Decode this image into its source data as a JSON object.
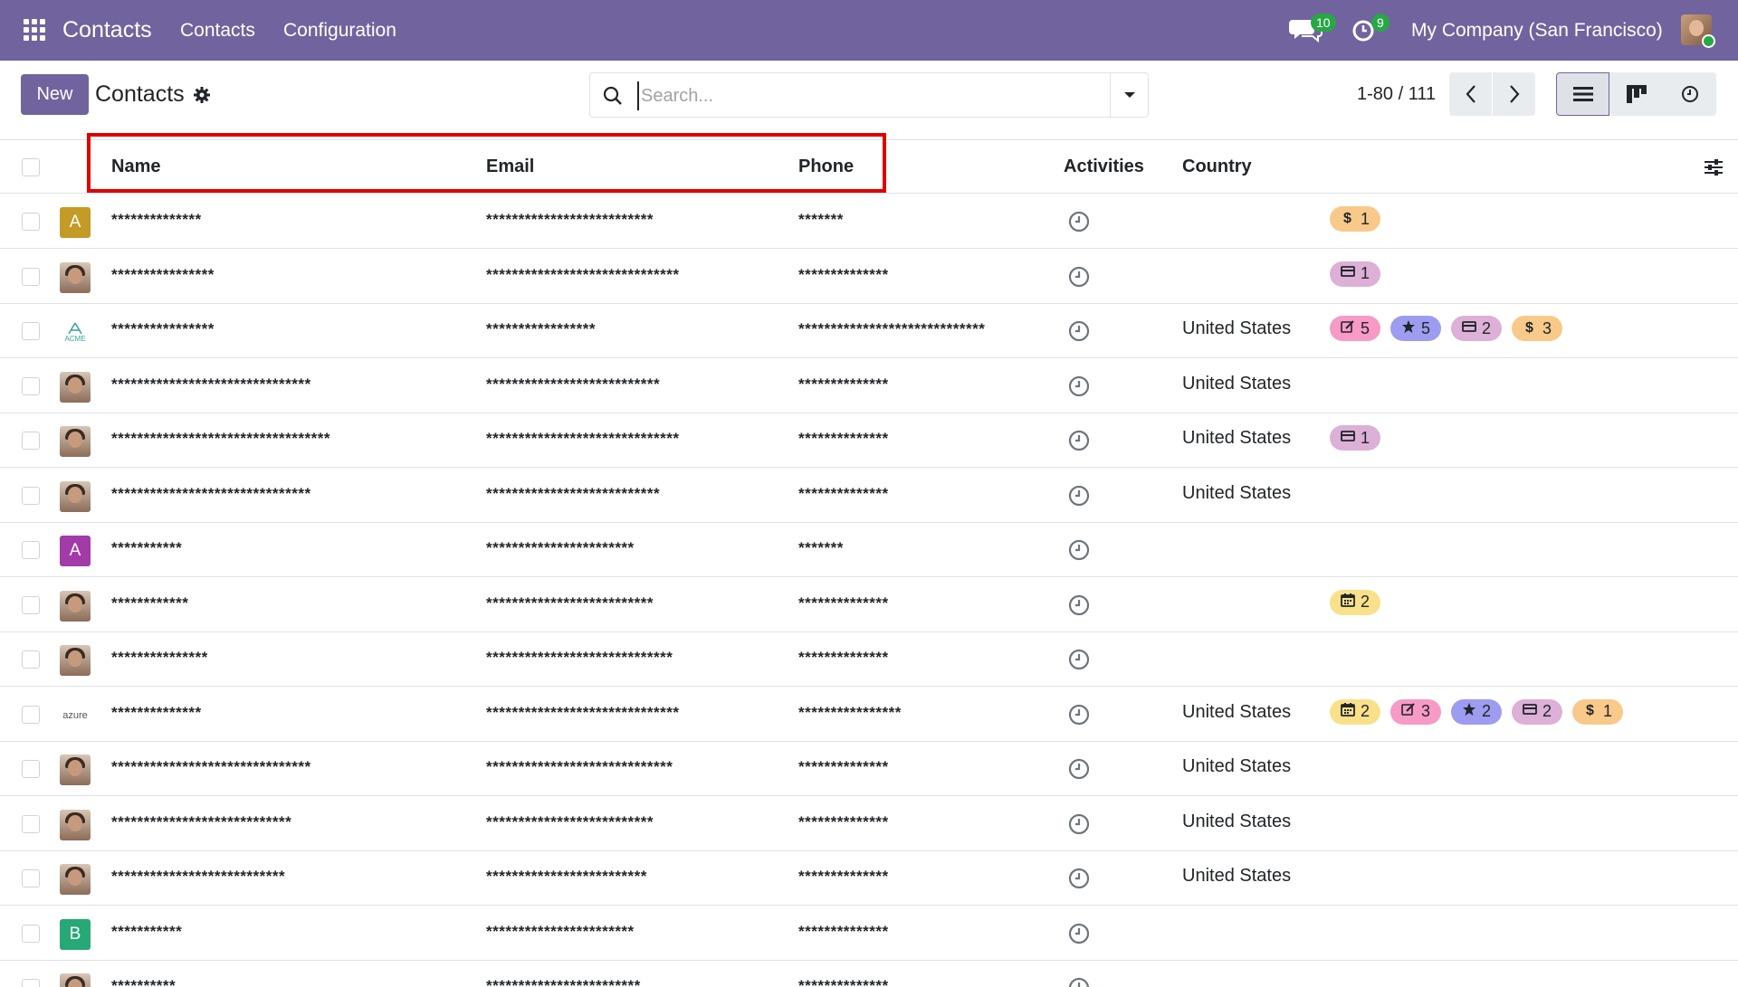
{
  "navbar": {
    "app_title": "Contacts",
    "menu": [
      "Contacts",
      "Configuration"
    ],
    "messages_count": "10",
    "activities_count": "9",
    "company": "My Company (San Francisco)"
  },
  "control_panel": {
    "new_label": "New",
    "title": "Contacts",
    "search_placeholder": "Search...",
    "pager": "1-80 / 111"
  },
  "table": {
    "columns": [
      "Name",
      "Email",
      "Phone",
      "Activities",
      "Country"
    ],
    "rows": [
      {
        "avatar": "A",
        "avatar_color": "#c49b26",
        "name": "**************",
        "email": "**************************",
        "phone": "*******",
        "country": "",
        "tags": [
          {
            "kind": "dollar",
            "value": "1"
          }
        ]
      },
      {
        "avatar": "photo",
        "name": "****************",
        "email": "******************************",
        "phone": "**************",
        "country": "",
        "tags": [
          {
            "kind": "card",
            "value": "1"
          }
        ]
      },
      {
        "avatar": "acme",
        "name": "****************",
        "email": "*****************",
        "phone": "*****************************",
        "country": "United States",
        "tags": [
          {
            "kind": "pen",
            "value": "5"
          },
          {
            "kind": "star",
            "value": "5"
          },
          {
            "kind": "card",
            "value": "2"
          },
          {
            "kind": "dollar",
            "value": "3"
          }
        ]
      },
      {
        "avatar": "photo",
        "name": "*******************************",
        "email": "***************************",
        "phone": "**************",
        "country": "United States",
        "tags": []
      },
      {
        "avatar": "photo",
        "name": "**********************************",
        "email": "******************************",
        "phone": "**************",
        "country": "United States",
        "tags": [
          {
            "kind": "card",
            "value": "1"
          }
        ]
      },
      {
        "avatar": "photo",
        "name": "*******************************",
        "email": "***************************",
        "phone": "**************",
        "country": "United States",
        "tags": []
      },
      {
        "avatar": "A",
        "avatar_color": "#a23ba8",
        "name": "***********",
        "email": "***********************",
        "phone": "*******",
        "country": "",
        "tags": []
      },
      {
        "avatar": "photo",
        "name": "************",
        "email": "**************************",
        "phone": "**************",
        "country": "",
        "tags": [
          {
            "kind": "cal",
            "value": "2"
          }
        ]
      },
      {
        "avatar": "photo",
        "name": "***************",
        "email": "*****************************",
        "phone": "**************",
        "country": "",
        "tags": []
      },
      {
        "avatar": "azure",
        "name": "**************",
        "email": "******************************",
        "phone": "****************",
        "country": "United States",
        "tags": [
          {
            "kind": "cal",
            "value": "2"
          },
          {
            "kind": "pen",
            "value": "3"
          },
          {
            "kind": "star",
            "value": "2"
          },
          {
            "kind": "card",
            "value": "2"
          },
          {
            "kind": "dollar",
            "value": "1"
          }
        ]
      },
      {
        "avatar": "photo",
        "name": "*******************************",
        "email": "*****************************",
        "phone": "**************",
        "country": "United States",
        "tags": []
      },
      {
        "avatar": "photo",
        "name": "****************************",
        "email": "**************************",
        "phone": "**************",
        "country": "United States",
        "tags": []
      },
      {
        "avatar": "photo",
        "name": "***************************",
        "email": "*************************",
        "phone": "**************",
        "country": "United States",
        "tags": []
      },
      {
        "avatar": "B",
        "avatar_color": "#27a877",
        "name": "***********",
        "email": "***********************",
        "phone": "**************",
        "country": "",
        "tags": []
      },
      {
        "avatar": "photo",
        "name": "**********",
        "email": "************************",
        "phone": "**************",
        "country": "",
        "tags": []
      }
    ]
  },
  "colors": {
    "brand": "#71639e",
    "highlight": "#e00000"
  }
}
